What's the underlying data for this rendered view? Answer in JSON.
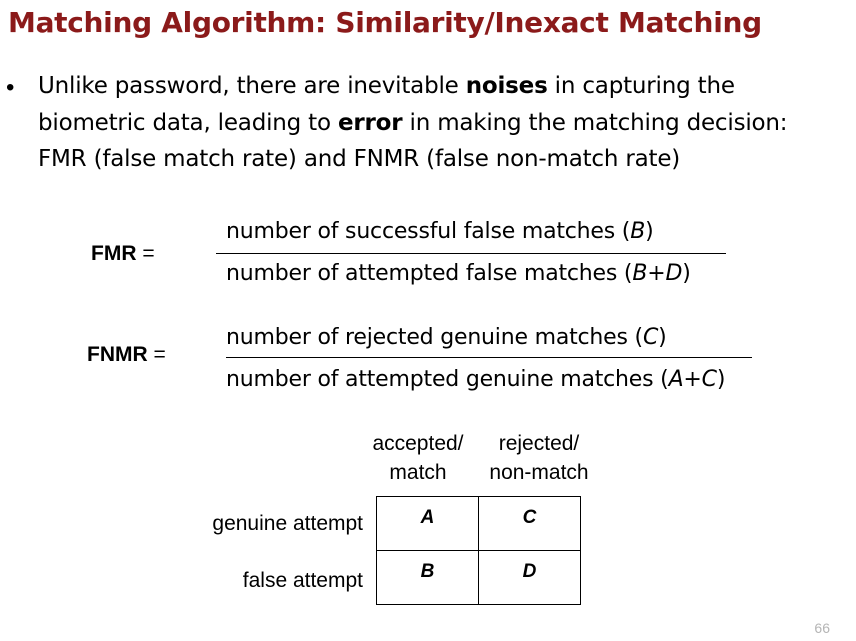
{
  "title": "Matching Algorithm: Similarity/Inexact Matching",
  "bullet": {
    "marker": "•",
    "line1_pre": "Unlike password, there are inevitable ",
    "line1_bold": "noises",
    "line1_post": " in capturing the",
    "line2_pre": "biometric data, leading to ",
    "line2_bold": "error",
    "line2_post": " in making the matching decision:",
    "line3": "FMR (false match rate) and FNMR (false non-match rate)"
  },
  "fmr": {
    "label": "FMR",
    "equals": " =",
    "numerator_text": "number of successful false matches (",
    "numerator_var": "B",
    "numerator_close": ")",
    "denominator_text": "number of attempted false matches (",
    "denominator_var": "B+D",
    "denominator_close": ")"
  },
  "fnmr": {
    "label": "FNMR",
    "equals": " =",
    "numerator_text": "number of rejected genuine matches (",
    "numerator_var": "C",
    "numerator_close": ")",
    "denominator_text": "number of attempted genuine matches (",
    "denominator_var": "A+C",
    "denominator_close": ")"
  },
  "matrix": {
    "col_headers": [
      {
        "line1": "accepted/",
        "line2": "match"
      },
      {
        "line1": "rejected/",
        "line2": "non-match"
      }
    ],
    "row_labels": [
      "genuine attempt",
      "false attempt"
    ],
    "cells": [
      [
        "A",
        "C"
      ],
      [
        "B",
        "D"
      ]
    ]
  },
  "page_number": "66",
  "colors": {
    "title": "#8b1a1a",
    "page_number": "#b5b5b5"
  }
}
